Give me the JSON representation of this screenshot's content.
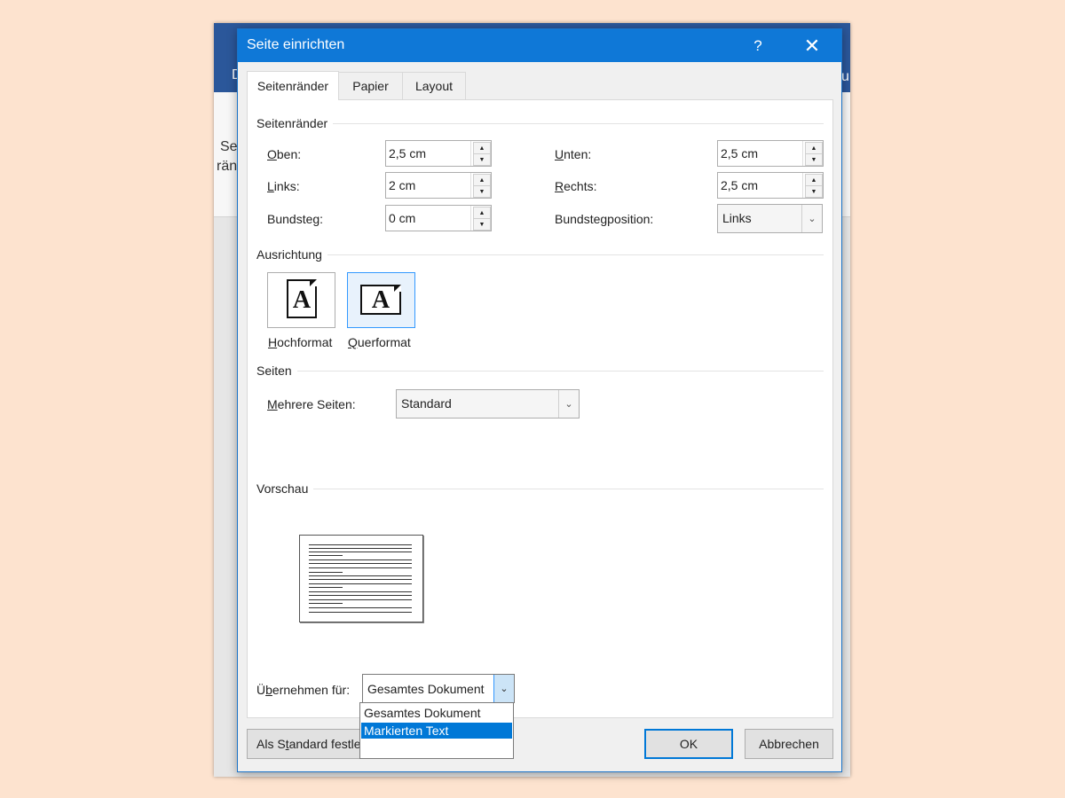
{
  "background": {
    "partial_texts": [
      "D",
      "Se",
      "rän",
      "u"
    ]
  },
  "dialog": {
    "title": "Seite einrichten",
    "help_label": "?",
    "close_label": "✕",
    "tabs": [
      {
        "label": "Seitenränder",
        "active": true
      },
      {
        "label": "Papier",
        "active": false
      },
      {
        "label": "Layout",
        "active": false
      }
    ],
    "margins": {
      "group_title": "Seitenränder",
      "top": {
        "label": "Oben:",
        "value": "2,5 cm"
      },
      "bottom": {
        "label": "Unten:",
        "value": "2,5 cm"
      },
      "left": {
        "label": "Links:",
        "value": "2 cm"
      },
      "right": {
        "label": "Rechts:",
        "value": "2,5 cm"
      },
      "gutter": {
        "label": "Bundsteg:",
        "value": "0 cm"
      },
      "gutter_position": {
        "label": "Bundstegposition:",
        "value": "Links"
      }
    },
    "orientation": {
      "group_title": "Ausrichtung",
      "portrait": {
        "label": "Hochformat",
        "letter": "A"
      },
      "landscape": {
        "label": "Querformat",
        "letter": "A",
        "selected": true
      }
    },
    "pages": {
      "group_title": "Seiten",
      "multiple_pages": {
        "label": "Mehrere Seiten:",
        "value": "Standard"
      }
    },
    "preview": {
      "group_title": "Vorschau"
    },
    "apply_to": {
      "label": "Übernehmen für:",
      "value": "Gesamtes Dokument",
      "options": [
        "Gesamtes Dokument",
        "Markierten Text",
        ""
      ],
      "highlighted_index": 1
    },
    "buttons": {
      "set_default": "Als Standard festle",
      "ok": "OK",
      "cancel": "Abbrechen"
    }
  },
  "colors": {
    "desktop": "#fde3cf",
    "titlebar": "#0f78d7",
    "highlight": "#0078d7"
  }
}
